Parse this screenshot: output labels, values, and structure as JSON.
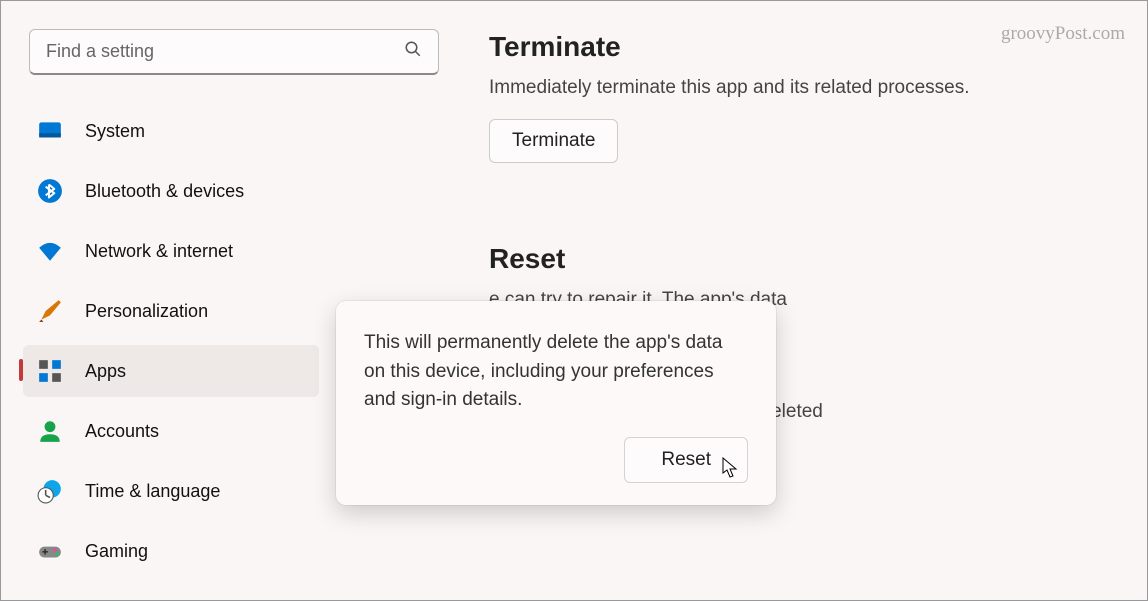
{
  "watermark": "groovyPost.com",
  "search": {
    "placeholder": "Find a setting"
  },
  "sidebar": {
    "items": [
      {
        "label": "System"
      },
      {
        "label": "Bluetooth & devices"
      },
      {
        "label": "Network & internet"
      },
      {
        "label": "Personalization"
      },
      {
        "label": "Apps"
      },
      {
        "label": "Accounts"
      },
      {
        "label": "Time & language"
      },
      {
        "label": "Gaming"
      }
    ]
  },
  "main": {
    "terminate": {
      "title": "Terminate",
      "desc": "Immediately terminate this app and its related processes.",
      "button": "Terminate"
    },
    "reset": {
      "title": "Reset",
      "desc1_suffix": "e can try to repair it. The app's data",
      "desc2_suffix": "t, reset it. The app's data will be deleted",
      "button": "Reset"
    }
  },
  "flyout": {
    "text": "This will permanently delete the app's data on this device, including your preferences and sign-in details.",
    "button": "Reset"
  }
}
